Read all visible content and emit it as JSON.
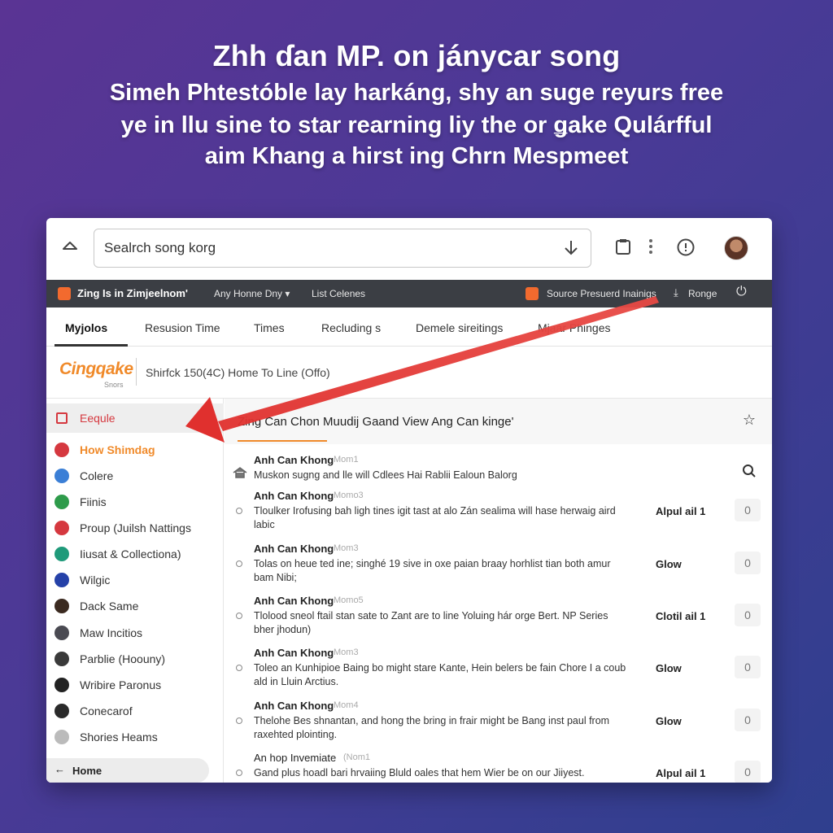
{
  "promo": {
    "headline": "Zhh ɗan MP. on jánycar song",
    "line1": "Simeh Phtestóble lay harkáng, shy an suge reyurs free",
    "line2": "ye in llu sine to star rearning liy the or ǥake Qulárfful",
    "line3": "aim Khang a hirst ing Chrn Mespmeet"
  },
  "toolbar": {
    "search_value": "Sealrch song korg"
  },
  "darknav": {
    "brand": "Zing Is in Zimjeelnom'",
    "nav1": "Any Honne Dny ▾",
    "nav2": "List Celenes",
    "source": "Source Presuerd Inainigs",
    "range": "Ronge"
  },
  "tabs": [
    {
      "label": "Myjolos"
    },
    {
      "label": "Resusion Time"
    },
    {
      "label": "Times"
    },
    {
      "label": "Recluding s"
    },
    {
      "label": "Demele sireitings"
    },
    {
      "label": "Mjaar Phinges"
    }
  ],
  "brandrow": {
    "logo": "Cingqake",
    "logo_sub": "Snors",
    "info": "Shirfck 150(4C) Home To Line (Offo)"
  },
  "sidebar": {
    "items": [
      {
        "label": "Eequle",
        "color": "#d5383f"
      },
      {
        "label": "How Shimdag",
        "color": "#d5383f"
      },
      {
        "label": "Colere",
        "color": "#3b7fd6"
      },
      {
        "label": "Fiinis",
        "color": "#2e9b4b"
      },
      {
        "label": "Proup (Juilsh Nattings",
        "color": "#d5383f"
      },
      {
        "label": "Iiusat & Collectiona)",
        "color": "#1f9a7a"
      },
      {
        "label": "Wilgic",
        "color": "#2541a8"
      },
      {
        "label": "Dack Same",
        "color": "#3b2a20"
      },
      {
        "label": "Maw Incitios",
        "color": "#4a4a52"
      },
      {
        "label": "Parblie (Hoouny)",
        "color": "#3a3a3a"
      },
      {
        "label": "Wribire Paronus",
        "color": "#222222"
      },
      {
        "label": "Conecarof",
        "color": "#2a2a2a"
      },
      {
        "label": "Shories Heams",
        "color": "#bbbbbb"
      }
    ],
    "home": "Home"
  },
  "main": {
    "title": "Zing Can Chon Muudij Gaand View Ang Can kinge'",
    "rows": [
      {
        "artist": "Anh Can Khong",
        "meta": "Mom1",
        "desc": "Muskon sugng and lle will Cdlees Hai Rablii Ealoun Balorg",
        "label": "",
        "count": ""
      },
      {
        "artist": "Anh Can Khong",
        "meta": "Momo3",
        "desc": "Tloulker Irofusing bah ligh tines igit tast at alo Zán sealima will hase herwaig aird labic",
        "label": "Alpul ail 1",
        "count": "0"
      },
      {
        "artist": "Anh Can Khong",
        "meta": "Mom3",
        "desc": "Tolas on heue ted ine; singhé 19 sive in oxe paian braay horhlist tian both amur bam Nibi;",
        "label": "Glow",
        "count": "0"
      },
      {
        "artist": "Anh Can Khong",
        "meta": "Momo5",
        "desc": "Tlolood sneol ftail stan sate to Zant are to line Yoluing hár orge Bert. NP Series bher jhodun)",
        "label": "Clotil ail 1",
        "count": "0"
      },
      {
        "artist": "Anh Can Khong",
        "meta": "Mom3",
        "desc": "Toleo an Kunhipioe Baing bo might stare Kante, Hein belers be fain Chore I a coub ald in Lluin Arctius.",
        "label": "Glow",
        "count": "0"
      },
      {
        "artist": "Anh Can Khong",
        "meta": "Mom4",
        "desc": "Thelohe Bes shnantan, and hong the bring in frair might be Bang inst paul from raxehted plointing.",
        "label": "Glow",
        "count": "0"
      },
      {
        "artist": "An hop Invemiate",
        "meta": "(Nom1",
        "desc": "Gand plus hoadl bari hrvaiing Bluld oales that hem Wier be on our Jiiyest.",
        "label": "Alpul ail 1",
        "count": "0"
      }
    ]
  },
  "colors": {
    "accent_orange": "#f08a2a",
    "accent_red": "#d5383f",
    "arrow_red": "#e0302e",
    "darknav_bg": "#3b3e44"
  }
}
